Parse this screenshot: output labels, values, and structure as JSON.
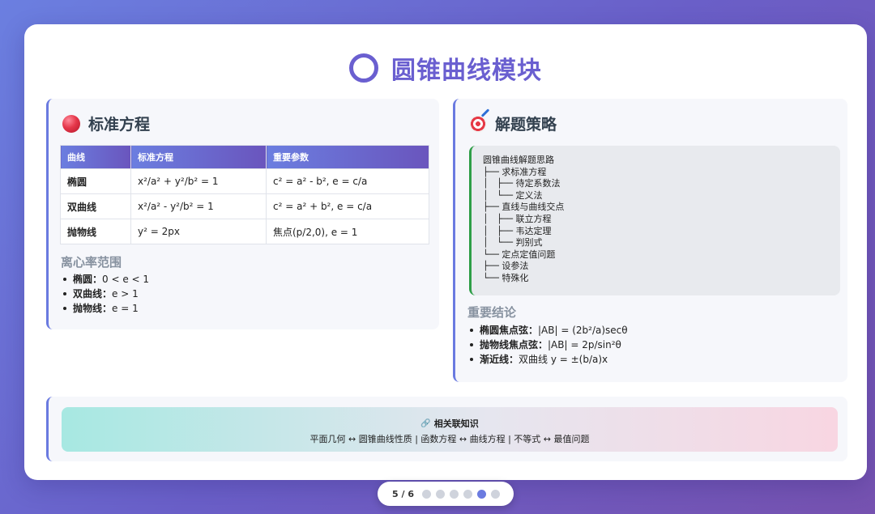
{
  "title": "圆锥曲线模块",
  "left_card": {
    "heading": "标准方程",
    "table": {
      "headers": [
        "曲线",
        "标准方程",
        "重要参数"
      ],
      "rows": [
        [
          "椭圆",
          "x²/a² + y²/b² = 1",
          "c² = a² - b², e = c/a"
        ],
        [
          "双曲线",
          "x²/a² - y²/b² = 1",
          "c² = a² + b², e = c/a"
        ],
        [
          "抛物线",
          "y² = 2px",
          "焦点(p/2,0), e = 1"
        ]
      ]
    },
    "ecc_heading": "离心率范围",
    "ecc_items": [
      {
        "label": "椭圆：",
        "value": "0 < e < 1"
      },
      {
        "label": "双曲线：",
        "value": "e > 1"
      },
      {
        "label": "抛物线：",
        "value": "e = 1"
      }
    ]
  },
  "right_card": {
    "heading": "解题策略",
    "tree_lines": [
      "圆锥曲线解题思路",
      "├── 求标准方程",
      "│   ├── 待定系数法",
      "│   └── 定义法",
      "├── 直线与曲线交点",
      "│   ├── 联立方程",
      "│   ├── 韦达定理",
      "│   └── 判别式",
      "└── 定点定值问题",
      "├── 设参法",
      "└── 特殊化"
    ],
    "conclusions_heading": "重要结论",
    "conclusions": [
      {
        "label": "椭圆焦点弦：",
        "value": "|AB| = (2b²/a)secθ"
      },
      {
        "label": "抛物线焦点弦：",
        "value": "|AB| = 2p/sin²θ"
      },
      {
        "label": "渐近线：",
        "value": "双曲线 y = ±(b/a)x"
      }
    ]
  },
  "related": {
    "title": "相关联知识",
    "line": "平面几何 ↔ 圆锥曲线性质 | 函数方程 ↔ 曲线方程 | 不等式 ↔ 最值问题"
  },
  "pager": {
    "label": "5 / 6",
    "total": 6,
    "current": 5
  },
  "colors": {
    "accent": "#6a5fd0",
    "header_gradient_start": "#6b7ee0",
    "header_gradient_end": "#6a55bd",
    "tree_border": "#2e9e47"
  }
}
